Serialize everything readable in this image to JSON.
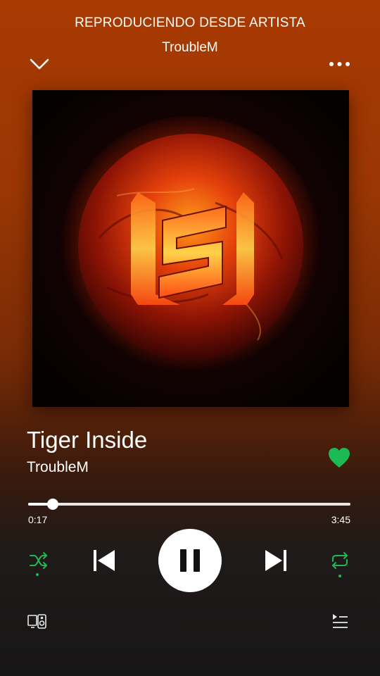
{
  "header": {
    "context_label": "REPRODUCIENDO DESDE ARTISTA",
    "context_name": "TroubleM"
  },
  "track": {
    "title": "Tiger Inside",
    "artist": "TroubleM",
    "liked": true
  },
  "playback": {
    "elapsed": "0:17",
    "total": "3:45",
    "progress_fraction": 0.0756,
    "state": "playing",
    "shuffle": true,
    "repeat": true
  },
  "icons": {
    "collapse": "chevron-down-icon",
    "more": "more-icon",
    "like": "heart-icon",
    "shuffle": "shuffle-icon",
    "previous": "skip-previous-icon",
    "pause": "pause-icon",
    "next": "skip-next-icon",
    "repeat": "repeat-icon",
    "devices": "devices-icon",
    "queue": "queue-icon"
  },
  "colors": {
    "accent": "#1db954",
    "background_top": "#a83a02",
    "background_bottom": "#171616"
  }
}
